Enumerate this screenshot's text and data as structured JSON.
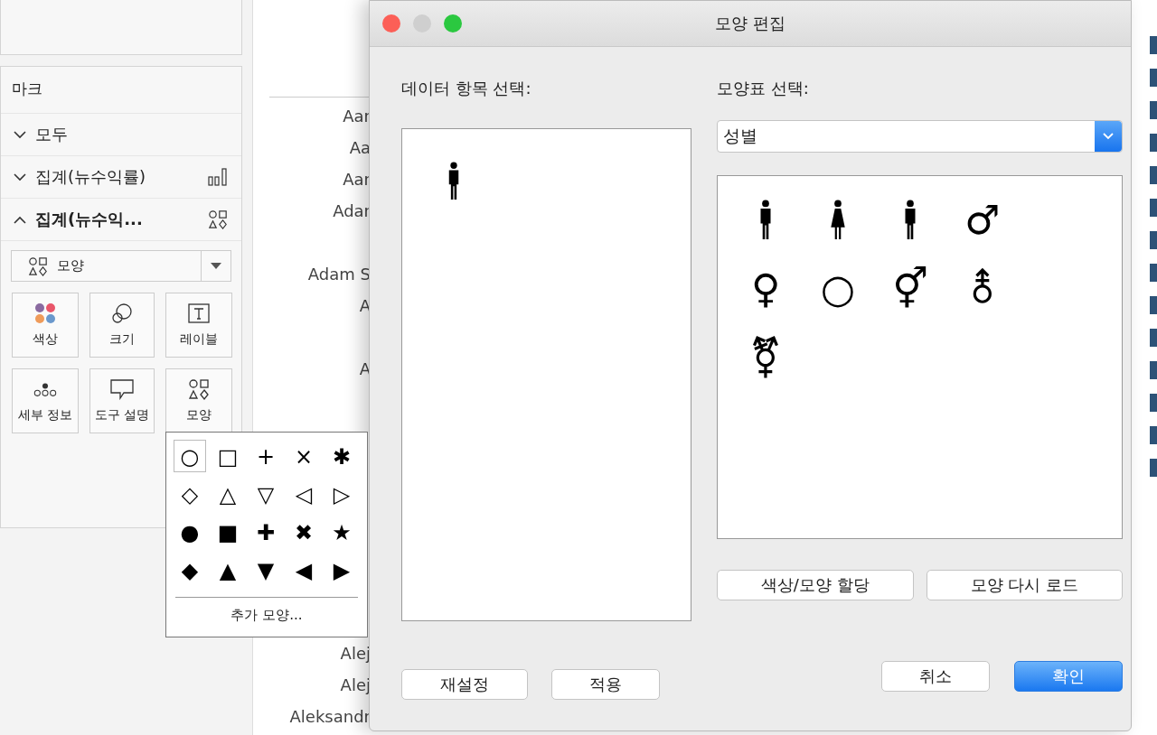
{
  "marks_card": {
    "title": "마크",
    "rows": [
      {
        "label": "모두",
        "expanded": false,
        "kind": "all"
      },
      {
        "label": "집계(뉴수익률)",
        "expanded": false,
        "kind": "bars"
      },
      {
        "label": "집계(뉴수익...",
        "expanded": true,
        "kind": "shapes"
      }
    ],
    "mark_type": {
      "value": "모양"
    },
    "properties": [
      {
        "label": "색상",
        "kind": "color"
      },
      {
        "label": "크기",
        "kind": "size"
      },
      {
        "label": "레이블",
        "kind": "label"
      },
      {
        "label": "세부 정보",
        "kind": "detail"
      },
      {
        "label": "도구 설명",
        "kind": "tooltip"
      },
      {
        "label": "모양",
        "kind": "shape"
      }
    ]
  },
  "shape_menu": {
    "shapes": [
      {
        "symbol": "○",
        "selected": true
      },
      {
        "symbol": "□",
        "selected": false
      },
      {
        "symbol": "+",
        "selected": false
      },
      {
        "symbol": "×",
        "selected": false
      },
      {
        "symbol": "✱",
        "selected": false
      },
      {
        "symbol": "◇",
        "selected": false
      },
      {
        "symbol": "△",
        "selected": false
      },
      {
        "symbol": "▽",
        "selected": false
      },
      {
        "symbol": "◁",
        "selected": false
      },
      {
        "symbol": "▷",
        "selected": false
      },
      {
        "symbol": "●",
        "selected": false
      },
      {
        "symbol": "■",
        "selected": false
      },
      {
        "symbol": "✚",
        "selected": false
      },
      {
        "symbol": "✖",
        "selected": false
      },
      {
        "symbol": "★",
        "selected": false
      },
      {
        "symbol": "◆",
        "selected": false
      },
      {
        "symbol": "▲",
        "selected": false
      },
      {
        "symbol": "▼",
        "selected": false
      },
      {
        "symbol": "◀",
        "selected": false
      },
      {
        "symbol": "▶",
        "selected": false
      }
    ],
    "more": "추가 모양..."
  },
  "row_labels": [
    "Aar",
    "Aa",
    "Aar",
    "Adar",
    "Adam S",
    "A",
    "A",
    "Alej",
    "Alej",
    "Aleksandr"
  ],
  "dialog": {
    "title": "모양 편집",
    "data_items_label": "데이터 항목 선택:",
    "data_items": [
      {
        "kind": "man",
        "selected": false
      }
    ],
    "palette_label": "모양표 선택:",
    "palette": {
      "value": "성별"
    },
    "palette_shapes": [
      {
        "kind": "man"
      },
      {
        "kind": "woman"
      },
      {
        "kind": "man"
      },
      {
        "kind": "glyph",
        "symbol": "♂"
      },
      {
        "kind": "glyph",
        "symbol": "♀"
      },
      {
        "kind": "glyph",
        "symbol": "○"
      },
      {
        "kind": "glyph",
        "symbol": "⚥"
      },
      {
        "kind": "glyph",
        "symbol": "⚨"
      },
      {
        "kind": "glyph",
        "symbol": "⚧"
      }
    ],
    "side_buttons": [
      "색상/모양 할당",
      "모양 다시 로드"
    ],
    "left_buttons": [
      "재설정",
      "적용"
    ],
    "right_buttons": [
      {
        "label": "취소",
        "default": false
      },
      {
        "label": "확인",
        "default": true
      }
    ]
  }
}
